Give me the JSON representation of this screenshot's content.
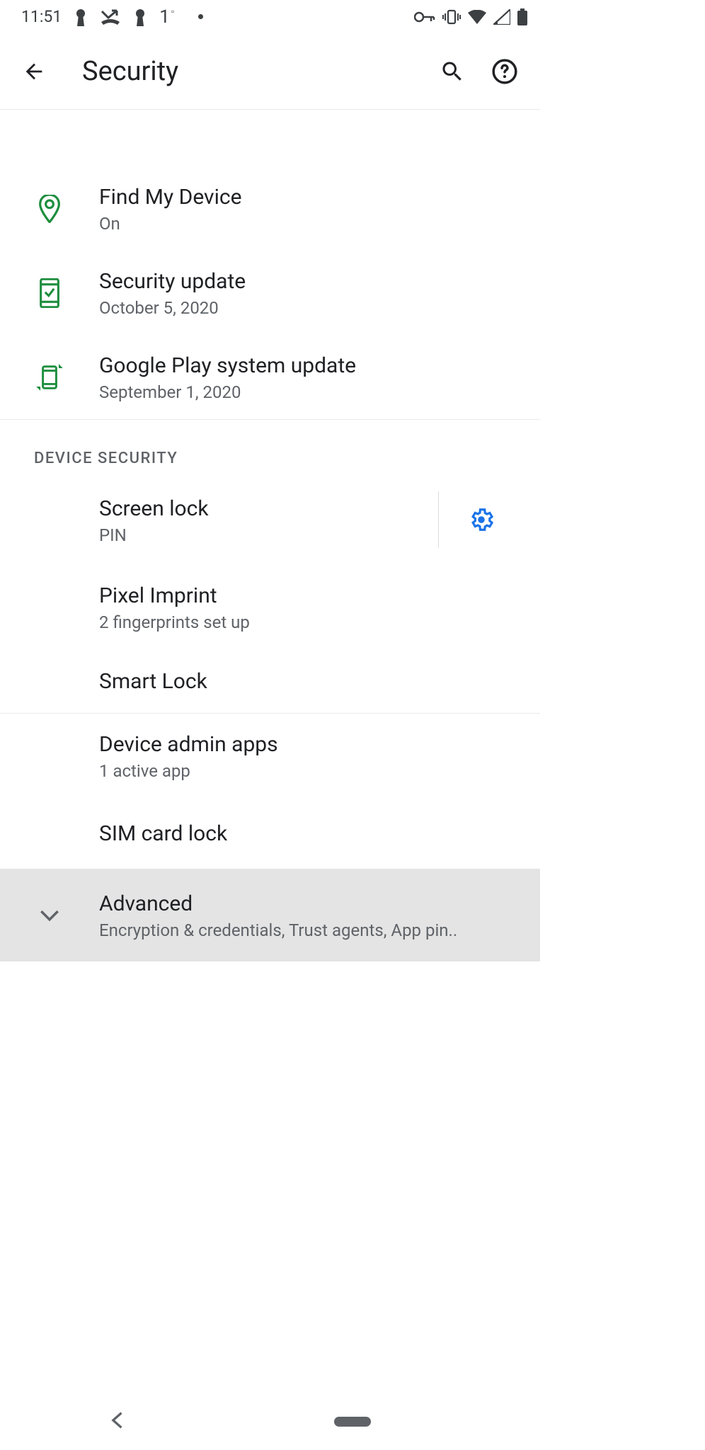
{
  "status": {
    "time": "11:51",
    "temp": "1"
  },
  "header": {
    "title": "Security"
  },
  "items": {
    "find_my_device": {
      "title": "Find My Device",
      "sub": "On"
    },
    "security_update": {
      "title": "Security update",
      "sub": "October 5, 2020"
    },
    "play_update": {
      "title": "Google Play system update",
      "sub": "September 1, 2020"
    }
  },
  "section": {
    "device_security": "DEVICE SECURITY"
  },
  "device_security": {
    "screen_lock": {
      "title": "Screen lock",
      "sub": "PIN"
    },
    "pixel_imprint": {
      "title": "Pixel Imprint",
      "sub": "2 fingerprints set up"
    },
    "smart_lock": {
      "title": "Smart Lock"
    },
    "device_admin": {
      "title": "Device admin apps",
      "sub": "1 active app"
    },
    "sim_lock": {
      "title": "SIM card lock"
    },
    "advanced": {
      "title": "Advanced",
      "sub": "Encryption & credentials, Trust agents, App pin.."
    }
  }
}
